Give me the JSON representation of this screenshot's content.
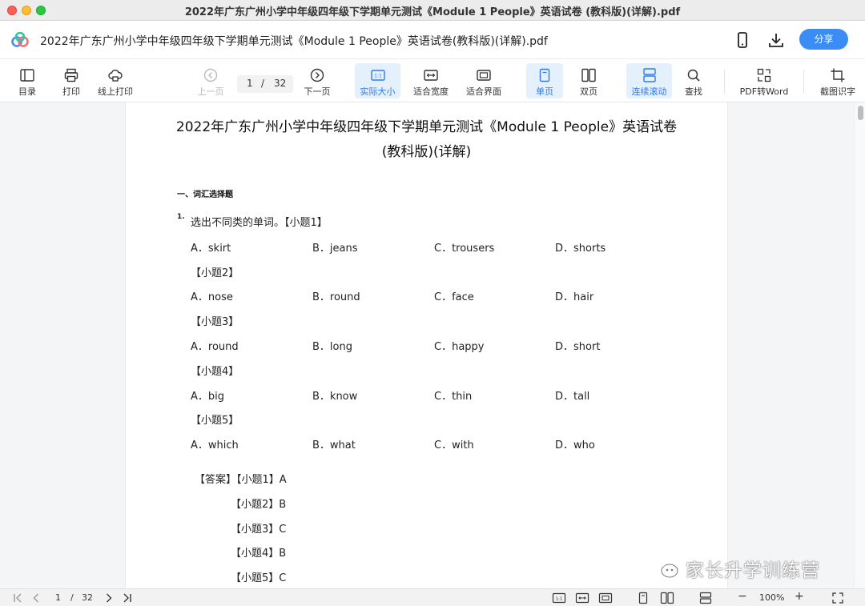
{
  "window": {
    "title": "2022年广东广州小学中年级四年级下学期单元测试《Module 1 People》英语试卷 (教科版)(详解).pdf"
  },
  "header": {
    "doc_title": "2022年广东广州小学中年级四年级下学期单元测试《Module 1 People》英语试卷(教科版)(详解).pdf",
    "share_label": "分享"
  },
  "toolbar": {
    "toc": "目录",
    "print": "打印",
    "online_print": "线上打印",
    "prev_page": "上一页",
    "next_page": "下一页",
    "page_current": "1",
    "page_sep": "/",
    "page_total": "32",
    "actual_size": "实际大小",
    "actual_size_icon": "1:1",
    "fit_width": "适合宽度",
    "fit_page": "适合界面",
    "single_page": "单页",
    "double_page": "双页",
    "continuous": "连续滚动",
    "search": "查找",
    "pdf_to_word": "PDF转Word",
    "ocr": "截图识字"
  },
  "document": {
    "title_line1": "2022年广东广州小学中年级四年级下学期单元测试《Module 1 People》英语试卷",
    "title_line2": "(教科版)(详解)",
    "section": "一、词汇选择题",
    "q_number": "1.",
    "q_stem": "选出不同类的单词。【小题1】",
    "subs": [
      "【小题2】",
      "【小题3】",
      "【小题4】",
      "【小题5】"
    ],
    "options": [
      [
        "A．skirt",
        "B．jeans",
        "C．trousers",
        "D．shorts"
      ],
      [
        "A．nose",
        "B．round",
        "C．face",
        "D．hair"
      ],
      [
        "A．round",
        "B．long",
        "C．happy",
        "D．short"
      ],
      [
        "A．big",
        "B．know",
        "C．thin",
        "D．tall"
      ],
      [
        "A．which",
        "B．what",
        "C．with",
        "D．who"
      ]
    ],
    "answer_head": "【答案】【小题1】A",
    "answers": [
      "【小题2】B",
      "【小题3】C",
      "【小题4】B",
      "【小题5】C"
    ]
  },
  "watermark": "家长升学训练营",
  "statusbar": {
    "page_current": "1",
    "page_sep": "/",
    "page_total": "32",
    "zoom": "100%",
    "fit_icon": "1:1",
    "minus": "−",
    "plus": "+"
  },
  "colors": {
    "accent": "#3b8df5",
    "active_bg": "#e5f0fd",
    "active_text": "#2f7ae5"
  }
}
